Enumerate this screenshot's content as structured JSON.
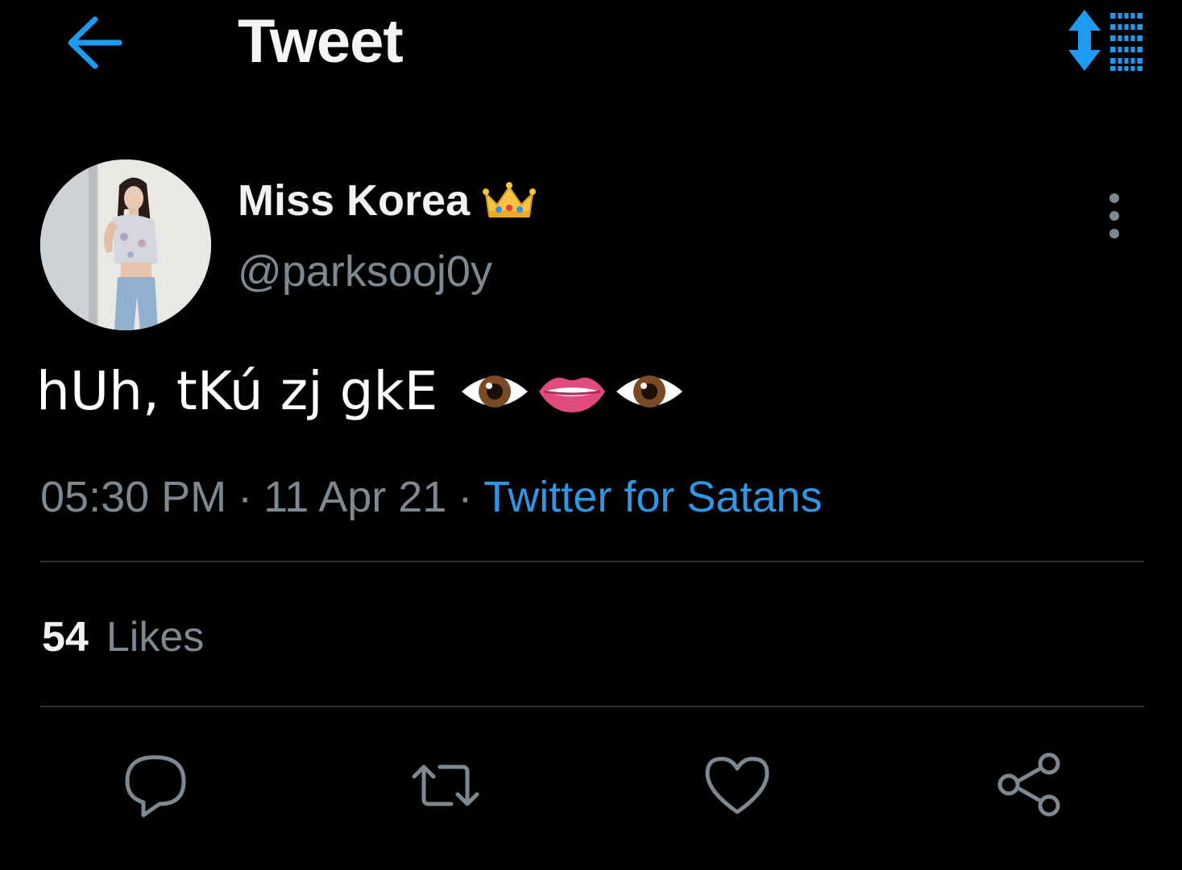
{
  "header": {
    "title": "Tweet",
    "back_icon": "arrow-left-icon",
    "sort_icon": "sort-list-icon",
    "accent": "#1d9bf0"
  },
  "tweet": {
    "author": {
      "display_name": "Miss Korea",
      "name_emoji": "crown-emoji",
      "handle": "@parksooj0y",
      "avatar": "profile-photo"
    },
    "text": "hUh, tKú zj gkE",
    "emojis": [
      "eye-emoji",
      "lips-emoji",
      "eye-emoji"
    ],
    "time": "05:30 PM",
    "date": "11 Apr 21",
    "separator": "·",
    "source": "Twitter for Satans",
    "likes_count": "54",
    "likes_label": "Likes"
  },
  "actions": [
    "reply-icon",
    "retweet-icon",
    "like-icon",
    "share-icon"
  ],
  "colors": {
    "background": "#000000",
    "text": "#ffffff",
    "secondary": "#7e8890",
    "link": "#2d97e6",
    "divider": "#2b2f33"
  }
}
